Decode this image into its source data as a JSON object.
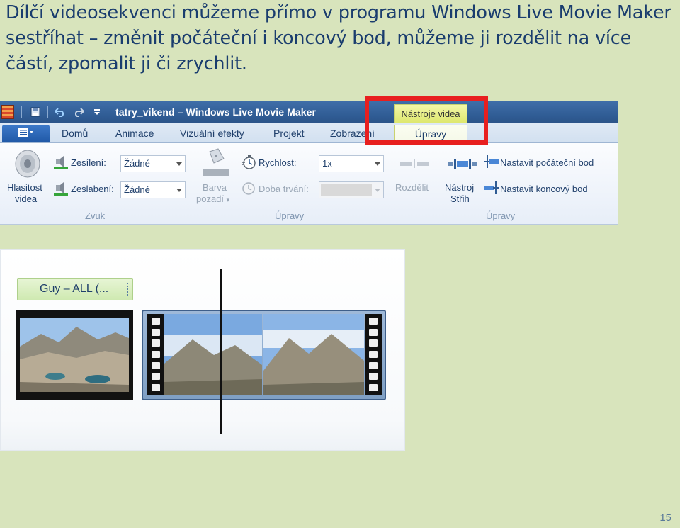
{
  "slide": {
    "text": "Dílčí videosekvenci můžeme přímo v programu Windows Live Movie Maker sestříhat – změnit počáteční i koncový bod, můžeme ji rozdělit na více částí, zpomalit ji či zrychlit.",
    "page_number": "15",
    "highlight_color": "#e81f1f",
    "background_color": "#d8e4bc"
  },
  "window": {
    "title": "tatry_vikend – Windows Live Movie Maker",
    "contextual_tab_group": "Nástroje videa",
    "qat_icons": [
      "save-icon",
      "undo-icon",
      "redo-icon",
      "customize-icon"
    ]
  },
  "tabs": {
    "file_icon": "menu-icon",
    "items": [
      "Domů",
      "Animace",
      "Vizuální efekty",
      "Projekt",
      "Zobrazení"
    ],
    "active": "Úpravy"
  },
  "ribbon": {
    "audio": {
      "volume_label": "Hlasitost",
      "volume_label2": "videa",
      "fade_in_label": "Zesílení:",
      "fade_in_value": "Žádné",
      "fade_out_label": "Zeslabení:",
      "fade_out_value": "Žádné",
      "group_label": "Zvuk"
    },
    "adjust": {
      "bg_color_label": "Barva",
      "bg_color_label2": "pozadí",
      "speed_label": "Rychlost:",
      "speed_value": "1x",
      "duration_label": "Doba trvání:",
      "group_label": "Úpravy"
    },
    "edit": {
      "split_label": "Rozdělit",
      "trim_label": "Nástroj",
      "trim_label2": "Střih",
      "set_start_label": "Nastavit počáteční bod",
      "set_end_label": "Nastavit koncový bod",
      "group_label": "Úpravy"
    }
  },
  "timeline": {
    "music_clip_label": "Guy – ALL (..."
  }
}
